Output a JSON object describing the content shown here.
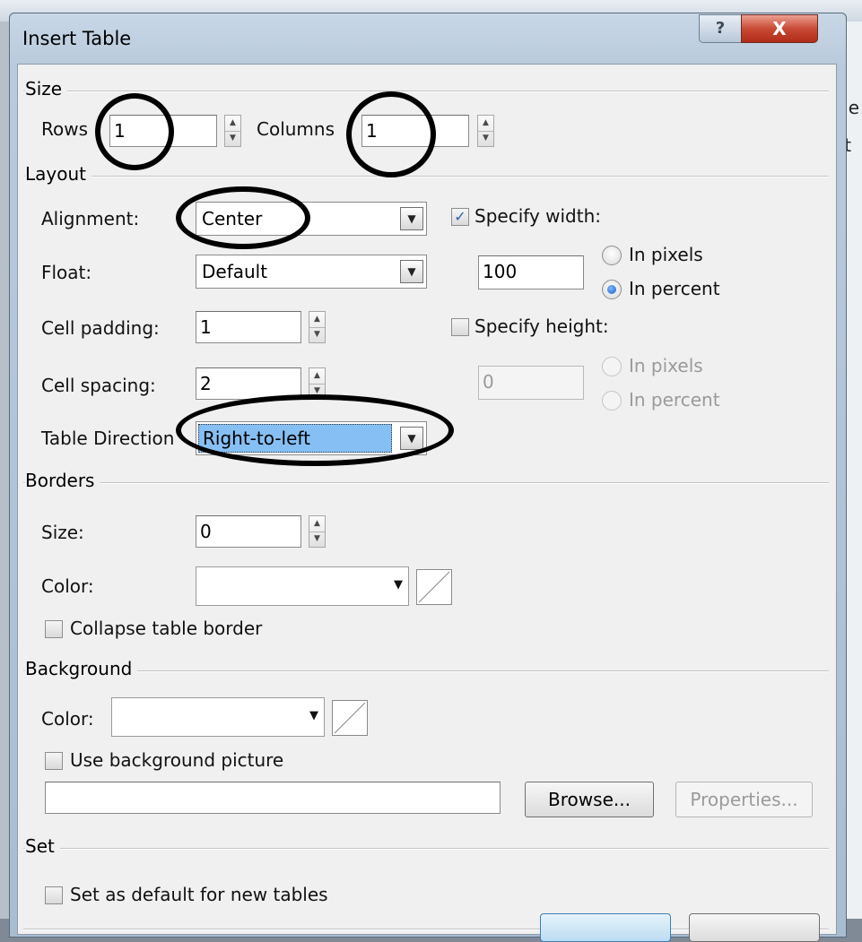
{
  "background": {
    "right_edge_text": [
      "ge",
      "rt"
    ]
  },
  "dialog": {
    "title": "Insert Table",
    "help_glyph": "?",
    "close_glyph": "X"
  },
  "size": {
    "section": "Size",
    "rows_label": "Rows",
    "rows_value": "1",
    "columns_label": "Columns",
    "columns_value": "1"
  },
  "layout": {
    "section": "Layout",
    "alignment_label": "Alignment:",
    "alignment_value": "Center",
    "float_label": "Float:",
    "float_value": "Default",
    "cell_padding_label": "Cell padding:",
    "cell_padding_value": "1",
    "cell_spacing_label": "Cell spacing:",
    "cell_spacing_value": "2",
    "direction_label": "Table Direction",
    "direction_value": "Right-to-left",
    "specify_width_label": "Specify width:",
    "specify_width_checked": true,
    "width_value": "100",
    "width_in_pixels": "In pixels",
    "width_in_percent": "In percent",
    "width_unit_selected": "In percent",
    "specify_height_label": "Specify height:",
    "specify_height_checked": false,
    "height_value": "0",
    "height_in_pixels": "In pixels",
    "height_in_percent": "In percent"
  },
  "borders": {
    "section": "Borders",
    "size_label": "Size:",
    "size_value": "0",
    "color_label": "Color:",
    "collapse_label": "Collapse table border",
    "collapse_checked": false
  },
  "background_section": {
    "section": "Background",
    "color_label": "Color:",
    "use_picture_label": "Use background picture",
    "use_picture_checked": false,
    "picture_path": "",
    "browse_label": "Browse...",
    "properties_label": "Properties..."
  },
  "set": {
    "section": "Set",
    "default_label": "Set as default for new tables",
    "default_checked": false
  },
  "colors": {
    "selection_highlight": "#86bff3",
    "annotation_ink": "#000000",
    "close_button": "#c94a35"
  },
  "icons": [
    "help-icon",
    "close-icon",
    "spinner-up-icon",
    "spinner-down-icon",
    "dropdown-arrow-icon",
    "no-color-swatch-icon",
    "checkmark-icon"
  ]
}
